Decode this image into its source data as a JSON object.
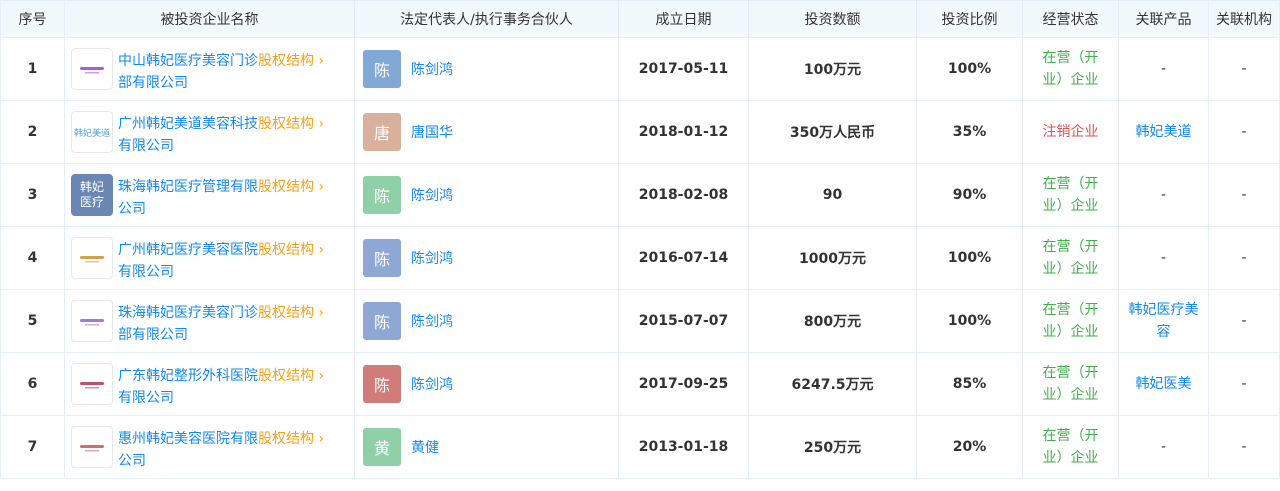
{
  "headers": {
    "index": "序号",
    "company": "被投资企业名称",
    "legal_rep": "法定代表人/执行事务合伙人",
    "founded": "成立日期",
    "amount": "投资数额",
    "ratio": "投资比例",
    "status": "经营状态",
    "products": "关联产品",
    "orgs": "关联机构"
  },
  "equity_label": "股权结构 ›",
  "colors": {
    "link": "#128bed",
    "equity": "#f9a11b",
    "active": "#3fb04b",
    "cancel": "#e84f4f",
    "header_bg": "#f2f9fc",
    "border": "#e4eef6"
  },
  "rows": [
    {
      "index": "1",
      "company_line1": "中山韩妃医疗美容门诊",
      "company_line2": "部有限公司",
      "logo_type": "mini-logo",
      "logo_color": "#b05bd0",
      "rep_initial": "陈",
      "rep_name": "陈剑鸿",
      "rep_color": "#82a8d6",
      "founded": "2017-05-11",
      "amount": "100万元",
      "ratio": "100%",
      "status_line1": "在营（开",
      "status_line2": "业）企业",
      "status_type": "active",
      "product_line1": "-",
      "product_line2": "",
      "org": "-"
    },
    {
      "index": "2",
      "company_line1": "广州韩妃美道美容科技",
      "company_line2": "有限公司",
      "logo_type": "text-logo",
      "logo_text": "韩妃美道",
      "logo_color": "#55a3d6",
      "rep_initial": "唐",
      "rep_name": "唐国华",
      "rep_color": "#d9b09c",
      "founded": "2018-01-12",
      "amount": "350万人民币",
      "ratio": "35%",
      "status_line1": "注销企业",
      "status_line2": "",
      "status_type": "cancel",
      "product_line1": "韩妃美道",
      "product_line2": "",
      "org": "-"
    },
    {
      "index": "3",
      "company_line1": "珠海韩妃医疗管理有限",
      "company_line2": "公司",
      "logo_type": "solid-logo",
      "logo_text1": "韩妃",
      "logo_text2": "医疗",
      "logo_color": "#6a86b3",
      "rep_initial": "陈",
      "rep_name": "陈剑鸿",
      "rep_color": "#8fd0a8",
      "founded": "2018-02-08",
      "amount": "90",
      "ratio": "90%",
      "status_line1": "在营（开",
      "status_line2": "业）企业",
      "status_type": "active",
      "product_line1": "-",
      "product_line2": "",
      "org": "-"
    },
    {
      "index": "4",
      "company_line1": "广州韩妃医疗美容医院",
      "company_line2": "有限公司",
      "logo_type": "mini-logo",
      "logo_color": "#d4a04a",
      "rep_initial": "陈",
      "rep_name": "陈剑鸿",
      "rep_color": "#8fa7d4",
      "founded": "2016-07-14",
      "amount": "1000万元",
      "ratio": "100%",
      "status_line1": "在营（开",
      "status_line2": "业）企业",
      "status_type": "active",
      "product_line1": "-",
      "product_line2": "",
      "org": "-"
    },
    {
      "index": "5",
      "company_line1": "珠海韩妃医疗美容门诊",
      "company_line2": "部有限公司",
      "logo_type": "mini-logo",
      "logo_color": "#a07ad6",
      "rep_initial": "陈",
      "rep_name": "陈剑鸿",
      "rep_color": "#8fa7d4",
      "founded": "2015-07-07",
      "amount": "800万元",
      "ratio": "100%",
      "status_line1": "在营（开",
      "status_line2": "业）企业",
      "status_type": "active",
      "product_line1": "韩妃医疗美",
      "product_line2": "容",
      "org": "-"
    },
    {
      "index": "6",
      "company_line1": "广东韩妃整形外科医院",
      "company_line2": "有限公司",
      "logo_type": "mini-logo",
      "logo_color": "#c0506a",
      "rep_initial": "陈",
      "rep_name": "陈剑鸿",
      "rep_color": "#d27b7b",
      "founded": "2017-09-25",
      "amount": "6247.5万元",
      "ratio": "85%",
      "status_line1": "在营（开",
      "status_line2": "业）企业",
      "status_type": "active",
      "product_line1": "韩妃医美",
      "product_line2": "",
      "org": "-"
    },
    {
      "index": "7",
      "company_line1": "惠州韩妃美容医院有限",
      "company_line2": "公司",
      "logo_type": "mini-logo",
      "logo_color": "#d86a6a",
      "rep_initial": "黄",
      "rep_name": "黄健",
      "rep_color": "#8fd0a8",
      "founded": "2013-01-18",
      "amount": "250万元",
      "ratio": "20%",
      "status_line1": "在营（开",
      "status_line2": "业）企业",
      "status_type": "active",
      "product_line1": "-",
      "product_line2": "",
      "org": "-"
    }
  ]
}
